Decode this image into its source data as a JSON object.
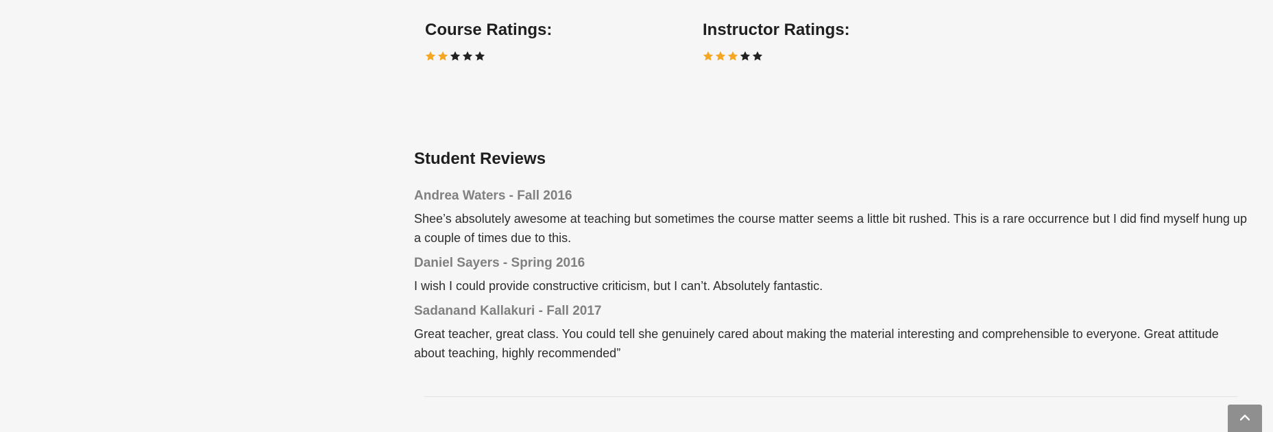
{
  "ratings": {
    "course": {
      "title": "Course Ratings:",
      "value": 2,
      "max": 5
    },
    "instructor": {
      "title": "Instructor Ratings:",
      "value": 3,
      "max": 5
    }
  },
  "colors": {
    "star_filled": "#f5a623",
    "star_empty": "#222222",
    "scroll_button": "#8f8f8f"
  },
  "reviews": {
    "title": "Student Reviews",
    "items": [
      {
        "reviewer": "Andrea Waters - Fall 2016",
        "text": "Shee’s absolutely awesome at teaching but sometimes the course matter seems a little bit rushed. This is a rare occurrence but I did find myself hung up a couple of times due to this."
      },
      {
        "reviewer": "Daniel Sayers - Spring 2016",
        "text": "I wish I could provide constructive criticism, but I can’t. Absolutely fantastic."
      },
      {
        "reviewer": "Sadanand Kallakuri - Fall 2017",
        "text": "Great teacher, great class. You could tell she genuinely cared about making the material interesting and comprehensible to everyone. Great attitude about teaching, highly recommended”"
      }
    ]
  },
  "scroll_top_icon": "chevron-up-icon"
}
